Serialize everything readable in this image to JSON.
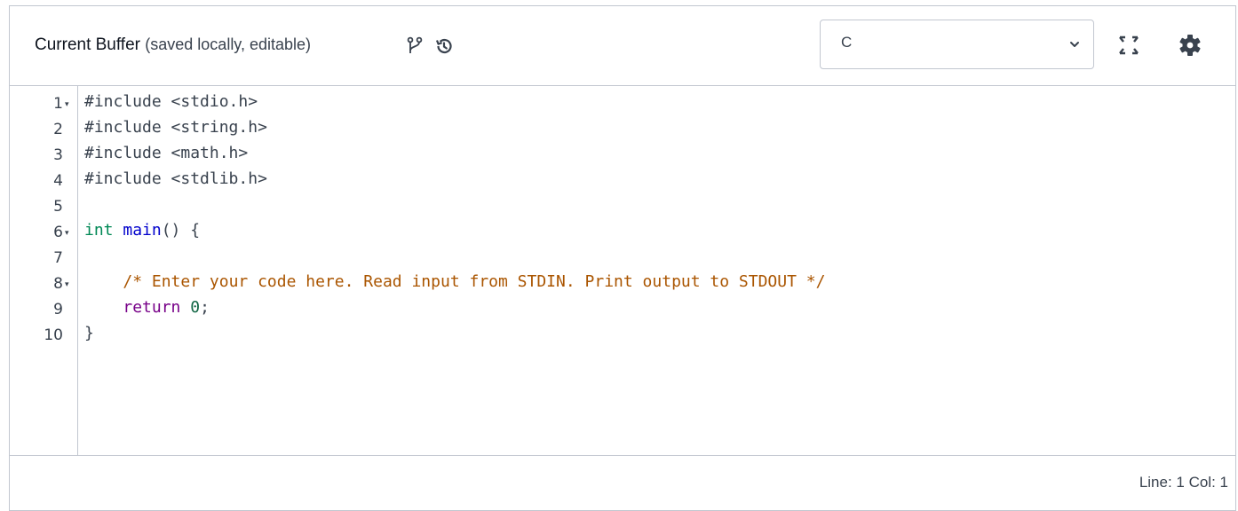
{
  "header": {
    "title_strong": "Current Buffer",
    "title_sub": "(saved locally, editable)",
    "icons": [
      "branch-icon",
      "history-icon"
    ]
  },
  "language_select": {
    "value": "C",
    "icon": "chevron-down-icon"
  },
  "toolbar": {
    "fullscreen_icon": "expand-icon",
    "settings_icon": "gear-icon"
  },
  "editor": {
    "line_numbers": [
      "1",
      "2",
      "3",
      "4",
      "5",
      "6",
      "7",
      "8",
      "9",
      "10"
    ],
    "fold_markers": [
      "▾",
      "",
      "",
      "",
      "",
      "▾",
      "",
      "▾",
      "",
      ""
    ],
    "lines": [
      "#include <stdio.h>",
      "#include <string.h>",
      "#include <math.h>",
      "#include <stdlib.h>",
      "",
      "int main() {",
      "",
      "    /* Enter your code here. Read input from STDIN. Print output to STDOUT */",
      "    return 0;",
      "}"
    ],
    "tokens": {
      "kw_int": "int",
      "fn_main": "main",
      "main_rest": "() {",
      "indent": "    ",
      "comment": "/* Enter your code here. Read input from STDIN. Print output to STDOUT */",
      "kw_return": "return",
      "num_zero": "0",
      "semicolon": ";"
    }
  },
  "status_bar": {
    "position": "Line: 1 Col: 1"
  },
  "colors": {
    "border": "#c2c7d0",
    "text": "#39424e",
    "keyword_type": "#008855",
    "keyword_def": "#0000cc",
    "keyword_return": "#770088",
    "number": "#116644",
    "comment": "#aa5500"
  }
}
